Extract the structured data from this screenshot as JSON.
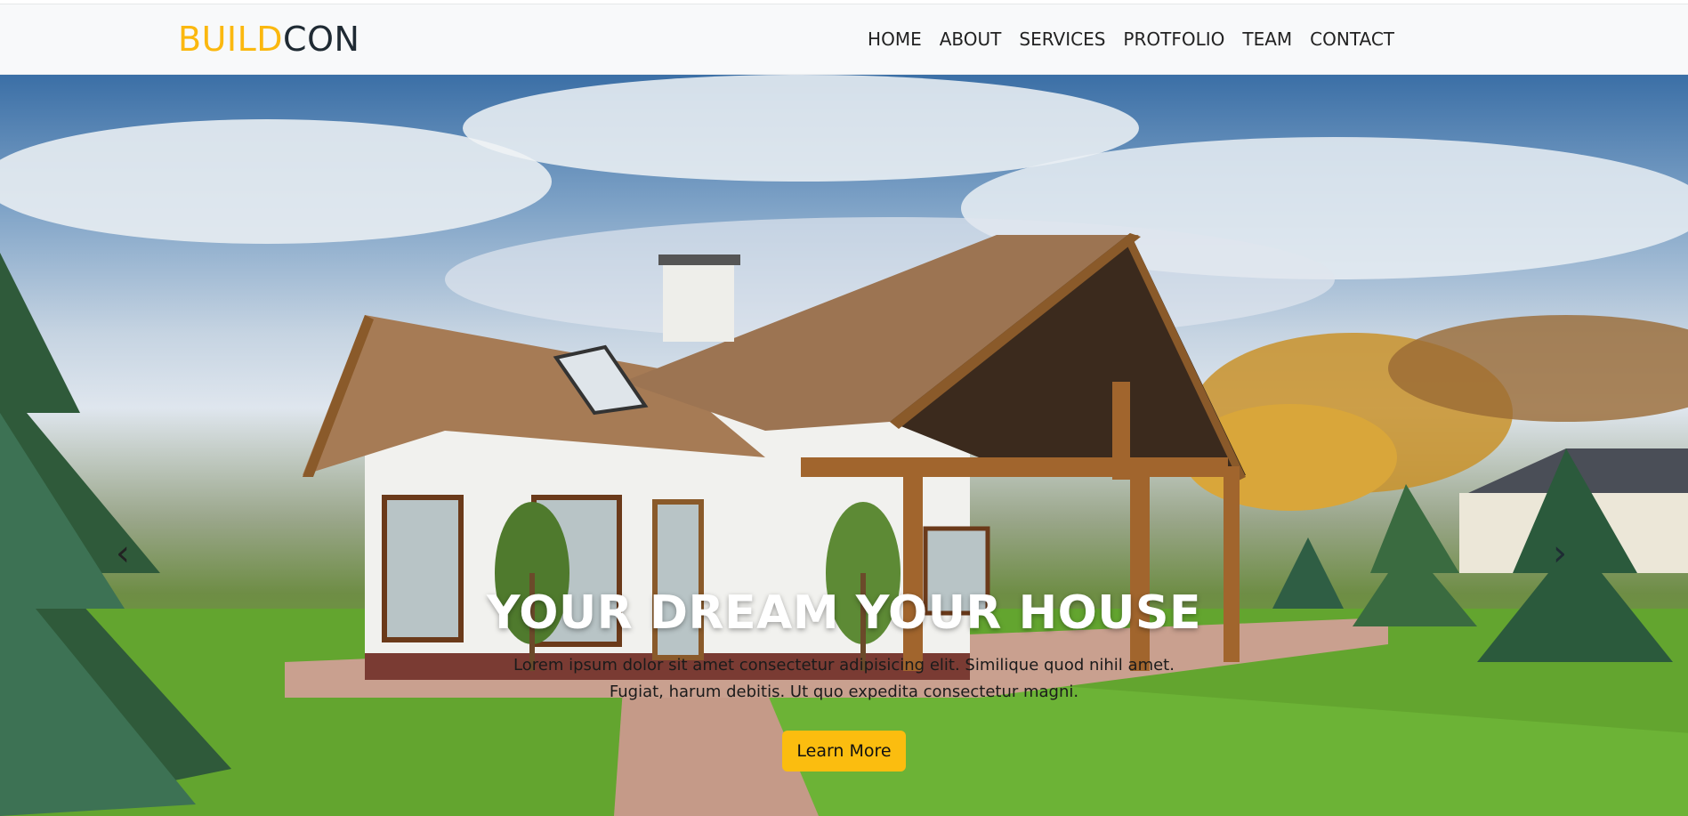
{
  "brand": {
    "part1": "BUILD",
    "part2": "CON"
  },
  "nav": {
    "items": [
      {
        "label": "HOME"
      },
      {
        "label": "ABOUT"
      },
      {
        "label": "SERVICES"
      },
      {
        "label": "PROTFOLIO"
      },
      {
        "label": "TEAM"
      },
      {
        "label": "CONTACT"
      }
    ]
  },
  "hero": {
    "title": "YOUR DREAM YOUR HOUSE",
    "text_line1": "Lorem ipsum dolor sit amet consectetur adipisicing elit. Similique quod nihil amet.",
    "text_line2": "Fugiat, harum debitis. Ut quo expedita consectetur magni.",
    "cta_label": "Learn More",
    "prev_icon": "chevron-left-icon",
    "next_icon": "chevron-right-icon"
  },
  "colors": {
    "accent": "#fbbd0f",
    "brand_dark": "#1f2a33",
    "navbar_bg": "#f8f9fa"
  }
}
